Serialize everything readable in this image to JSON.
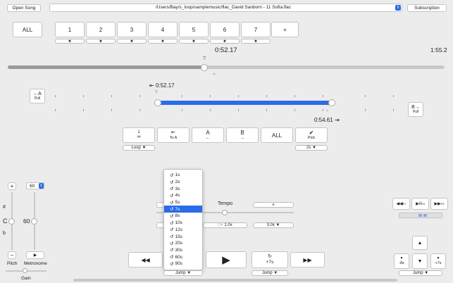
{
  "header": {
    "open_song": "Open Song",
    "path": "/Users/Bay/s_loop/samplemusic/flac_David Sanborn - 11 Sofia.flac",
    "subscription": "Subscription"
  },
  "markers": {
    "all": "ALL",
    "items": [
      "1",
      "2",
      "3",
      "4",
      "5",
      "6",
      "7"
    ],
    "add": "+",
    "remove_glyph": "✖"
  },
  "time": {
    "current": "0:52.17",
    "total": "1:55.2",
    "loop_start": "0:52.17",
    "loop_end": "0:54.61",
    "song_progress": 0.45
  },
  "loop": {
    "a_label": "←A",
    "a_sub": "Pull",
    "b_label": "B→",
    "b_sub": "Pull",
    "start_icon": "⇤",
    "end_icon": "⇥"
  },
  "controls": {
    "loop_glyph": "1",
    "loop_inf": "∞",
    "loop_menu": "Loop ▼",
    "toa_glyph": "⇤",
    "toa_label": "To A",
    "a_label": "A",
    "a_arrow": "←",
    "b_label": "B",
    "b_arrow": "→",
    "all": "ALL",
    "pick_glyph": "✔",
    "pick_label": "Pick",
    "pick_menu": "2s ▼"
  },
  "pitch": {
    "plus": "+",
    "minus": "−",
    "sharp": "#",
    "key": "C",
    "flat": "b",
    "label": "Pitch"
  },
  "metronome": {
    "value": "60",
    "bpm": "60",
    "label": "Metronome",
    "play": "▶"
  },
  "gain": {
    "label": "Gain"
  },
  "tempo": {
    "label": "Tempo",
    "plus": "+",
    "rate": "1.0x",
    "rate_prefix": "□+",
    "max_menu": "3.0x ▼"
  },
  "jump_popup": {
    "items": [
      "1s",
      "2s",
      "3s",
      "4s",
      "5s",
      "7s",
      "8s",
      "10s",
      "12s",
      "15s",
      "20s",
      "30s",
      "60s",
      "90s"
    ],
    "selected_index": 5,
    "icon": "↺"
  },
  "transport": {
    "rewind": "◀◀",
    "play": "▶",
    "fwd7_icon": "↻",
    "fwd7_label": "+7s",
    "fast_fwd": "▶▶",
    "jump_menu": "Jump ▼",
    "jump_menu2": "Jump ▼"
  },
  "keys": {
    "rew": "◀◀",
    "rew_key": "F7",
    "playpause": "▶II",
    "pp_key": "F8",
    "ff": "▶▶",
    "ff_key": "F9",
    "up": "▲",
    "down": "▼",
    "left_label": "-8s",
    "right_label": "+7s",
    "jump_menu": "Jump ▼"
  }
}
